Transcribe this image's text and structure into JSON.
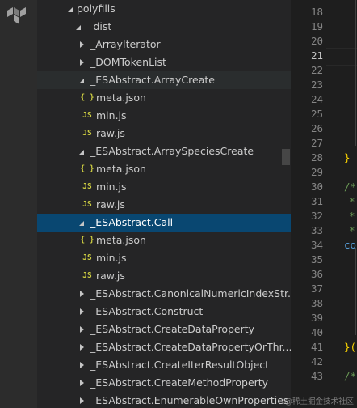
{
  "explorer": {
    "items": [
      {
        "label": "polyfills",
        "kind": "folder",
        "expanded": true
      },
      {
        "label": "__dist",
        "kind": "folder",
        "expanded": true
      },
      {
        "label": "_ArrayIterator",
        "kind": "folder",
        "expanded": false
      },
      {
        "label": "_DOMTokenList",
        "kind": "folder",
        "expanded": false
      },
      {
        "label": "_ESAbstract.ArrayCreate",
        "kind": "folder",
        "expanded": true
      },
      {
        "label": "meta.json",
        "kind": "json"
      },
      {
        "label": "min.js",
        "kind": "js"
      },
      {
        "label": "raw.js",
        "kind": "js"
      },
      {
        "label": "_ESAbstract.ArraySpeciesCreate",
        "kind": "folder",
        "expanded": true
      },
      {
        "label": "meta.json",
        "kind": "json"
      },
      {
        "label": "min.js",
        "kind": "js"
      },
      {
        "label": "raw.js",
        "kind": "js"
      },
      {
        "label": "_ESAbstract.Call",
        "kind": "folder",
        "expanded": true
      },
      {
        "label": "meta.json",
        "kind": "json"
      },
      {
        "label": "min.js",
        "kind": "js"
      },
      {
        "label": "raw.js",
        "kind": "js"
      },
      {
        "label": "_ESAbstract.CanonicalNumericIndexStr...",
        "kind": "folder",
        "expanded": false
      },
      {
        "label": "_ESAbstract.Construct",
        "kind": "folder",
        "expanded": false
      },
      {
        "label": "_ESAbstract.CreateDataProperty",
        "kind": "folder",
        "expanded": false
      },
      {
        "label": "_ESAbstract.CreateDataPropertyOrThr...",
        "kind": "folder",
        "expanded": false
      },
      {
        "label": "_ESAbstract.CreateIterResultObject",
        "kind": "folder",
        "expanded": false
      },
      {
        "label": "_ESAbstract.CreateMethodProperty",
        "kind": "folder",
        "expanded": false
      },
      {
        "label": "_ESAbstract.EnumerableOwnProperties",
        "kind": "folder",
        "expanded": false
      }
    ],
    "selected_label": "_ESAbstract.Call",
    "hovered_label": "_ESAbstract.ArrayCreate"
  },
  "editor": {
    "line_numbers": [
      "18",
      "19",
      "20",
      "21",
      "22",
      "23",
      "24",
      "25",
      "26",
      "27",
      "28",
      "29",
      "30",
      "31",
      "32",
      "33",
      "34",
      "35",
      "36",
      "37",
      "38",
      "39",
      "40",
      "41",
      "42",
      "43"
    ],
    "current_line": "21",
    "code": [
      {
        "line": "28",
        "text": "}"
      },
      {
        "line": "30",
        "text": "/*"
      },
      {
        "line": "31",
        "text": "*"
      },
      {
        "line": "32",
        "text": "*"
      },
      {
        "line": "33",
        "text": "*"
      },
      {
        "line": "34",
        "text": "co"
      },
      {
        "line": "41",
        "text": "}("
      },
      {
        "line": "43",
        "text": "/*"
      }
    ]
  },
  "watermark": "@稀土掘金技术社区",
  "colors": {
    "selection": "#094771",
    "json_icon": "#cbcb41",
    "js_icon": "#cbcb41",
    "brace": "#ffd700",
    "comment": "#6a9955",
    "keyword": "#569cd6"
  },
  "icons": {
    "activity_logo": "terraform-icon",
    "folder_expanded": "chevron-down-icon",
    "folder_collapsed": "chevron-right-icon",
    "json_file": "json-braces-icon",
    "js_file": "js-icon"
  }
}
